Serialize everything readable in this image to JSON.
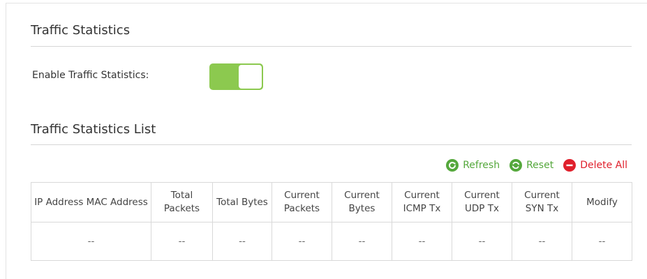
{
  "traffic_statistics": {
    "title": "Traffic Statistics",
    "enable_label": "Enable Traffic Statistics:",
    "enabled": true,
    "toggle_color": "#8cc94f"
  },
  "list": {
    "title": "Traffic Statistics List",
    "actions": {
      "refresh": {
        "label": "Refresh",
        "icon": "refresh-icon",
        "color": "#55a83c"
      },
      "reset": {
        "label": "Reset",
        "icon": "reset-icon",
        "color": "#55a83c"
      },
      "delete_all": {
        "label": "Delete All",
        "icon": "delete-icon",
        "color": "#e0202c"
      }
    },
    "columns": [
      "IP Address MAC Address",
      "Total Packets",
      "Total Bytes",
      "Current Packets",
      "Current Bytes",
      "Current ICMP Tx",
      "Current UDP Tx",
      "Current SYN Tx",
      "Modify"
    ],
    "rows": [
      [
        "--",
        "--",
        "--",
        "--",
        "--",
        "--",
        "--",
        "--",
        "--"
      ]
    ]
  }
}
